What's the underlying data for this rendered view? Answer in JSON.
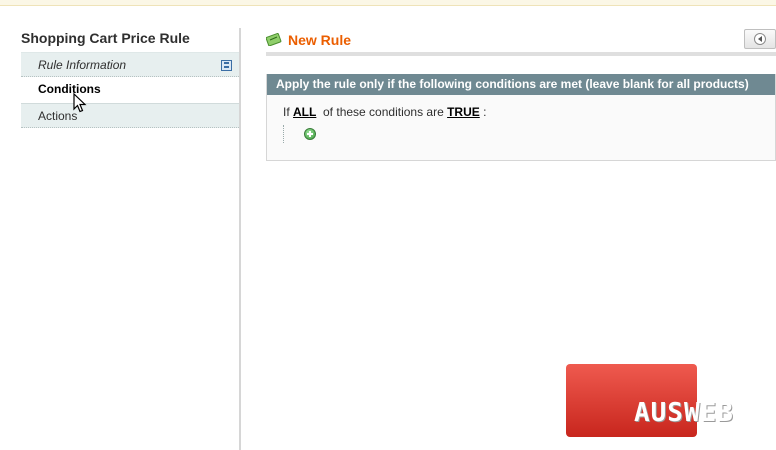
{
  "sidebar": {
    "title": "Shopping Cart Price Rule",
    "tabs": [
      {
        "label": "Rule Information",
        "icon": "save-icon"
      },
      {
        "label": "Conditions"
      },
      {
        "label": "Actions"
      }
    ]
  },
  "main": {
    "title": "New Rule",
    "title_icon": "rule-icon",
    "title_color": "#eb5e00",
    "back_icon": "back-arrow-icon",
    "fieldset": {
      "legend": "Apply the rule only if the following conditions are met (leave blank for all products)",
      "legend_bg": "#6f8992",
      "condition": {
        "prefix": "If ",
        "aggregator": "ALL",
        "middle": "  of these conditions are ",
        "value": "TRUE",
        "suffix": " :"
      },
      "add_icon": "add-condition-icon"
    }
  },
  "watermark": {
    "text": "AUSWEB",
    "color": "#d9372b"
  }
}
